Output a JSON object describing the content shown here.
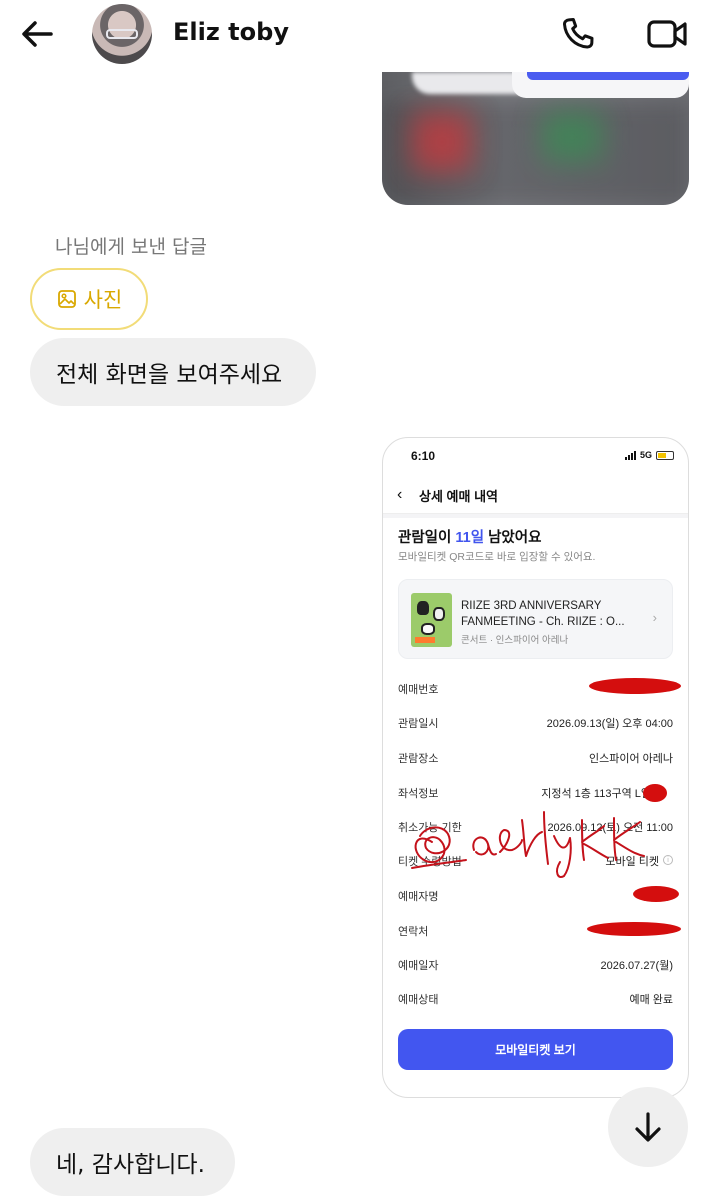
{
  "header": {
    "contact_name": "Eliz toby",
    "icons": [
      "back-arrow-icon",
      "phone-icon",
      "video-icon"
    ]
  },
  "messages": {
    "reply_label": "나님에게 보낸 답글",
    "photo_chip": "사진",
    "question": "전체 화면을 보여주세요",
    "answer": "네, 감사합니다."
  },
  "screenshot": {
    "status_time": "6:10",
    "network": "5G",
    "nav_title": "상세 예매 내역",
    "headline_prefix": "관람일이 ",
    "headline_days": "11일",
    "headline_suffix": " 남았어요",
    "subtitle": "모바일티켓 QR코드로 바로 입장할 수 있어요.",
    "event_title": "RIIZE 3RD ANNIVERSARY FANMEETING - Ch. RIIZE : O...",
    "event_meta": "콘서트 · 인스파이어 아레나",
    "rows": [
      {
        "key": "예매번호",
        "value": ""
      },
      {
        "key": "관람일시",
        "value": "2026.09.13(일) 오후 04:00"
      },
      {
        "key": "관람장소",
        "value": "인스파이어 아레나"
      },
      {
        "key": "좌석정보",
        "value": "지정석 1층 113구역 L열"
      },
      {
        "key": "취소가능 기한",
        "value": "2026.09.12(토) 오전 11:00"
      },
      {
        "key": "티켓 수령방법",
        "value": "모바일 티켓"
      },
      {
        "key": "예매자명",
        "value": ""
      },
      {
        "key": "연락처",
        "value": ""
      },
      {
        "key": "예매일자",
        "value": "2026.07.27(월)"
      },
      {
        "key": "예매상태",
        "value": "예매 완료"
      }
    ],
    "button": "모바일티켓 보기"
  },
  "colors": {
    "accent_blue": "#4256f0",
    "chip_yellow": "#f2dc78",
    "bubble_gray": "#efefef",
    "redaction_red": "#d40e0e"
  }
}
